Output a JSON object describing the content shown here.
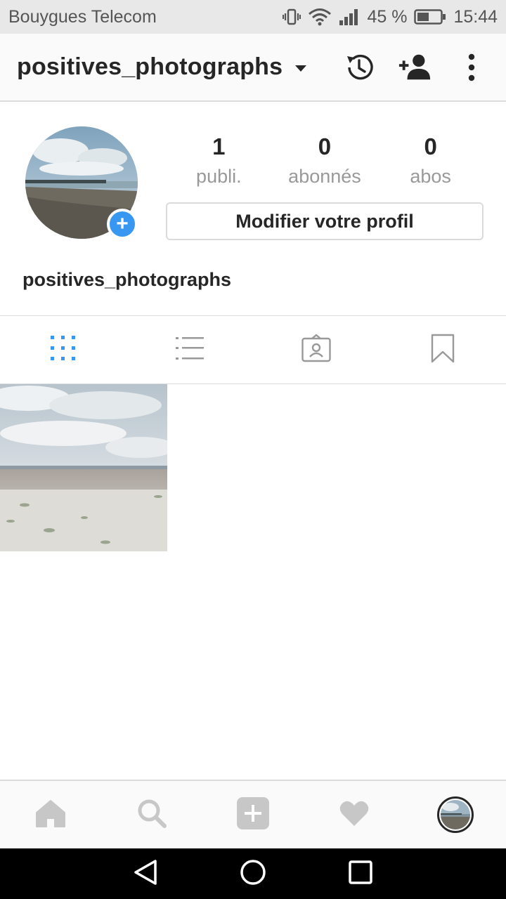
{
  "status_bar": {
    "carrier": "Bouygues Telecom",
    "battery": "45 %",
    "time": "15:44",
    "icons": [
      "vibrate-icon",
      "wifi-icon",
      "signal-icon",
      "battery-icon"
    ]
  },
  "header": {
    "username": "positives_photographs",
    "icons": [
      "dropdown-caret-icon",
      "history-icon",
      "add-user-icon",
      "more-options-icon"
    ]
  },
  "profile": {
    "stats": [
      {
        "value": "1",
        "label": "publi."
      },
      {
        "value": "0",
        "label": "abonnés"
      },
      {
        "value": "0",
        "label": "abos"
      }
    ],
    "edit_button": "Modifier votre profil",
    "display_name": "positives_photographs",
    "add_story_symbol": "+"
  },
  "view_tabs": {
    "items": [
      "grid-view-icon",
      "list-view-icon",
      "tagged-photos-icon",
      "saved-bookmark-icon"
    ],
    "active": "grid-view-icon",
    "active_color": "#3897f0",
    "inactive_color": "#999999"
  },
  "posts": {
    "count_shown": 1
  },
  "bottom_nav": {
    "items": [
      "home-icon",
      "search-icon",
      "new-post-icon",
      "activity-heart-icon",
      "profile-avatar"
    ]
  },
  "system_nav": {
    "items": [
      "back-icon",
      "home-circle-icon",
      "recents-square-icon"
    ]
  },
  "colors": {
    "accent": "#3897f0",
    "text": "#262626",
    "muted": "#999999",
    "divider": "#dbdbdb"
  }
}
